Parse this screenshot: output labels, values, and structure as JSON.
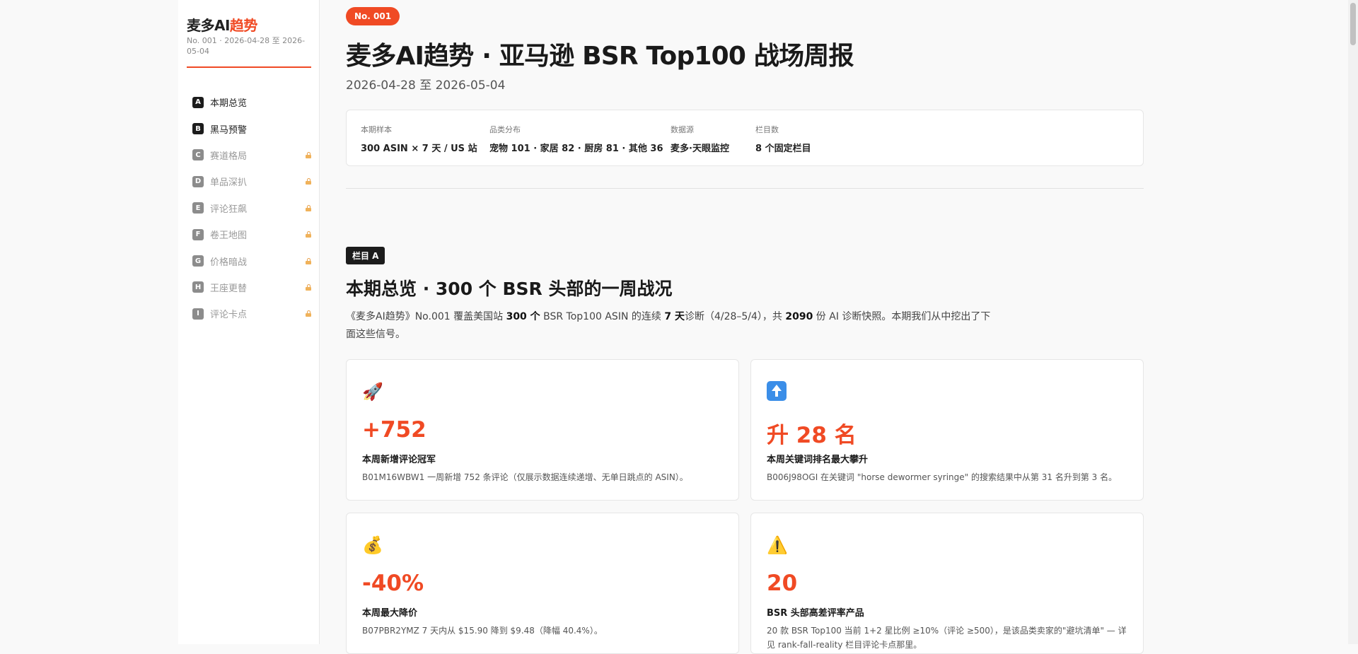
{
  "sidebar": {
    "brand_main": "麦多AI",
    "brand_accent": "趋势",
    "subtitle": "No. 001 · 2026-04-28 至 2026-05-04",
    "items": [
      {
        "letter": "A",
        "label": "本期总览",
        "locked": false
      },
      {
        "letter": "B",
        "label": "黑马预警",
        "locked": false
      },
      {
        "letter": "C",
        "label": "赛道格局",
        "locked": true
      },
      {
        "letter": "D",
        "label": "单品深扒",
        "locked": true
      },
      {
        "letter": "E",
        "label": "评论狂飙",
        "locked": true
      },
      {
        "letter": "F",
        "label": "卷王地图",
        "locked": true
      },
      {
        "letter": "G",
        "label": "价格暗战",
        "locked": true
      },
      {
        "letter": "H",
        "label": "王座更替",
        "locked": true
      },
      {
        "letter": "I",
        "label": "评论卡点",
        "locked": true
      }
    ]
  },
  "header": {
    "issue_badge": "No. 001",
    "title": "麦多AI趋势 · 亚马逊 BSR Top100 战场周报",
    "date_range": "2026-04-28 至 2026-05-04"
  },
  "info": [
    {
      "label": "本期样本",
      "value": "300 ASIN × 7 天 / US 站"
    },
    {
      "label": "品类分布",
      "value": "宠物 101 · 家居 82 · 厨房 81 · 其他 36"
    },
    {
      "label": "数据源",
      "value": "麦多·天眼监控"
    },
    {
      "label": "栏目数",
      "value": "8 个固定栏目"
    }
  ],
  "section": {
    "tag": "栏目 A",
    "title": "本期总览 · 300 个 BSR 头部的一周战况",
    "intro": {
      "p1": "《麦多AI趋势》No.001 覆盖美国站 ",
      "b1": "300 个",
      "p2": " BSR Top100 ASIN 的连续 ",
      "b2": "7 天",
      "p3": "诊断（4/28–5/4），共 ",
      "b3": "2090",
      "p4": " 份 AI 诊断快照。本期我们从中挖出了下面这些信号。"
    }
  },
  "cards": [
    {
      "icon": "rocket-icon",
      "glyph": "🚀",
      "big": "+752",
      "title": "本周新增评论冠军",
      "desc": "B01M16WBW1 一周新增 752 条评论（仅展示数据连续递增、无单日跳点的 ASIN）。"
    },
    {
      "icon": "up-arrow-icon",
      "glyph": "",
      "big": "升 28 名",
      "title": "本周关键词排名最大攀升",
      "desc": "B006J98OGI 在关键词 \"horse dewormer syringe\" 的搜索结果中从第 31 名升到第 3 名。"
    },
    {
      "icon": "money-bag-icon",
      "glyph": "💰",
      "big": "-40%",
      "title": "本周最大降价",
      "desc": "B07PBR2YMZ 7 天内从 $15.90 降到 $9.48（降幅 40.4%）。"
    },
    {
      "icon": "warning-icon",
      "glyph": "⚠️",
      "big": "20",
      "title": "BSR 头部高差评率产品",
      "desc": "20 款 BSR Top100 当前 1+2 星比例 ≥10%（评论 ≥500），是该品类卖家的\"避坑清单\" — 详见 rank-fall-reality 栏目评论卡点那里。"
    }
  ]
}
